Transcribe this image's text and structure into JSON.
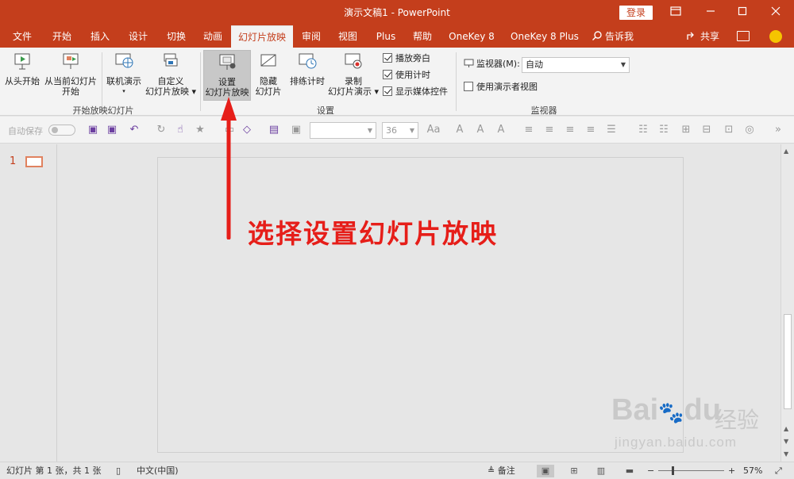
{
  "window": {
    "title": "演示文稿1  -  PowerPoint",
    "login_label": "登录",
    "ribbon_display_icon": "ribbon-display-icon",
    "minimize_icon": "minimize-icon",
    "maximize_icon": "maximize-icon",
    "close_icon": "close-icon"
  },
  "tabs": [
    {
      "label": "文件"
    },
    {
      "label": "开始"
    },
    {
      "label": "插入"
    },
    {
      "label": "设计"
    },
    {
      "label": "切换"
    },
    {
      "label": "动画"
    },
    {
      "label": "幻灯片放映",
      "active": true
    },
    {
      "label": "审阅"
    },
    {
      "label": "视图"
    },
    {
      "label": "Plus"
    },
    {
      "label": "帮助"
    },
    {
      "label": "OneKey 8"
    },
    {
      "label": "OneKey 8 Plus"
    }
  ],
  "tell_me": "告诉我",
  "share": "共享",
  "ribbon": {
    "start_group": {
      "label": "开始放映幻灯片",
      "from_beginning": "从头开始",
      "from_current_1": "从当前幻灯片",
      "from_current_2": "开始",
      "online": "联机演示",
      "custom_1": "自定义",
      "custom_2": "幻灯片放映"
    },
    "setup_group": {
      "label": "设置",
      "setup_1": "设置",
      "setup_2": "幻灯片放映",
      "hide_1": "隐藏",
      "hide_2": "幻灯片",
      "rehearse": "排练计时",
      "record_1": "录制",
      "record_2": "幻灯片演示",
      "play_narration": "播放旁白",
      "use_timings": "使用计时",
      "show_media_controls": "显示媒体控件"
    },
    "monitor_group": {
      "label": "监视器",
      "monitor_label": "监视器(M):",
      "monitor_value": "自动",
      "presenter_view": "使用演示者视图"
    }
  },
  "qat": {
    "autosave": "自动保存",
    "font_size": "36"
  },
  "slides": {
    "current_number": "1"
  },
  "annotation": {
    "text": "选择设置幻灯片放映"
  },
  "watermark": {
    "brand": "Bai",
    "brand2": "du",
    "cn": "经验",
    "url": "jingyan.baidu.com"
  },
  "status": {
    "slide_info": "幻灯片 第 1 张，共 1 张",
    "language": "中文(中国)",
    "notes": "备注",
    "zoom_minus": "−",
    "zoom_plus": "+",
    "zoom": "57%"
  },
  "colors": {
    "brand": "#c43e1c",
    "annotation": "#e61e19"
  }
}
